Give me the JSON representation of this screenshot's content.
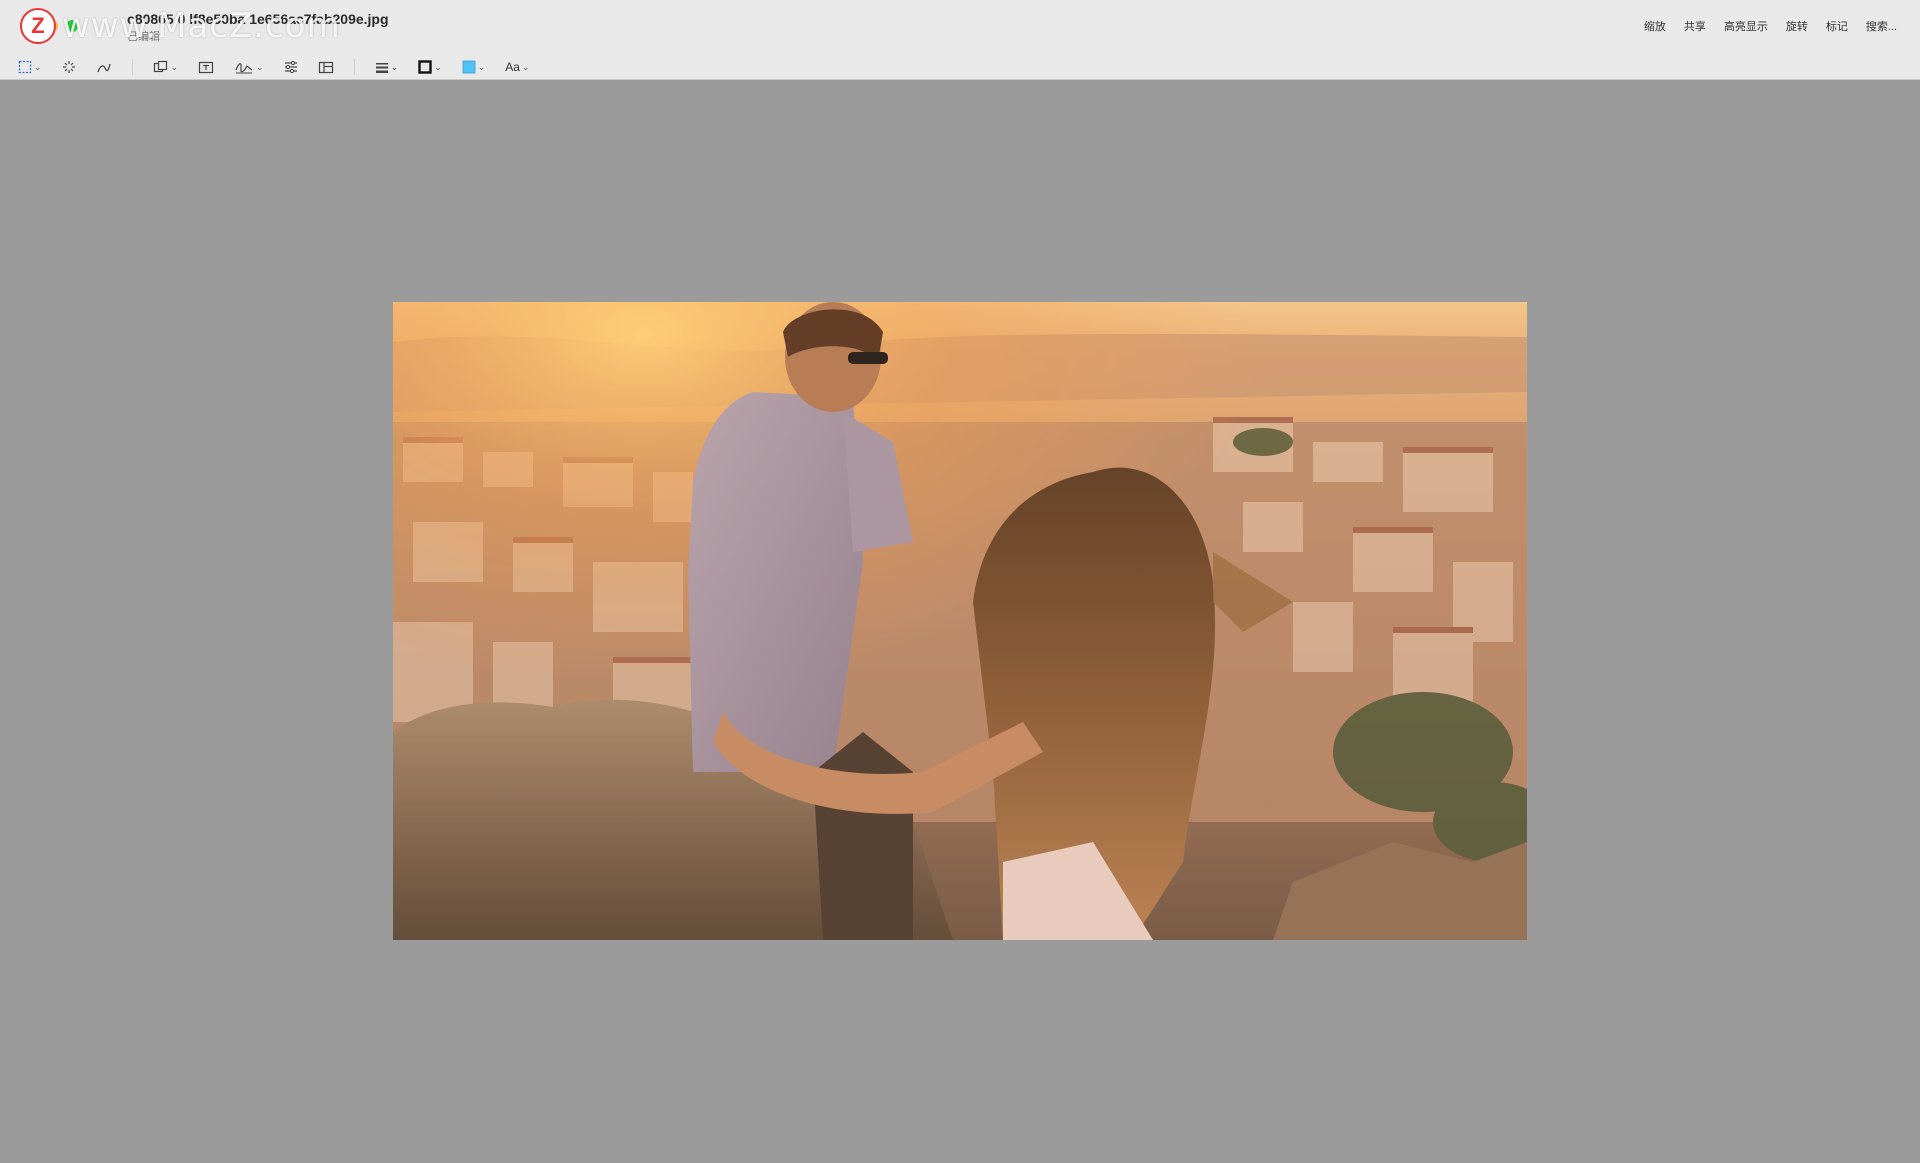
{
  "window": {
    "title": "c80865 0 lf8e50ba 1e656ac7fab209e.jpg",
    "subtitle": "已编辑"
  },
  "watermark": {
    "logo_letter": "Z",
    "text": "www.MacZ.com"
  },
  "toolbar_right": {
    "zoom": "缩放",
    "share": "共享",
    "highlight": "高亮显示",
    "rotate": "旋转",
    "markup": "标记",
    "search": "搜索..."
  },
  "toolbar": {
    "text_style_label": "Aa"
  },
  "colors": {
    "border_swatch": "#111111",
    "fill_swatch": "#4fc3f7",
    "canvas_background": "#9b9b9b"
  },
  "icons": [
    "selection-rectangle-icon",
    "instant-alpha-icon",
    "sketch-icon",
    "shapes-icon",
    "text-box-icon",
    "signature-icon",
    "adjust-color-icon",
    "adjust-size-icon",
    "line-style-icon",
    "border-color-icon",
    "fill-color-icon",
    "text-style-icon"
  ]
}
